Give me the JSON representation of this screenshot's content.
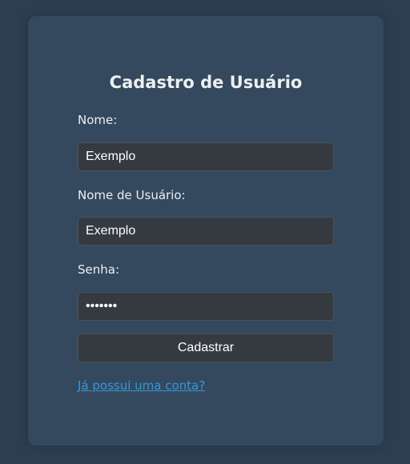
{
  "form": {
    "title": "Cadastro de Usuário",
    "name_label": "Nome:",
    "name_value": "Exemplo",
    "username_label": "Nome de Usuário:",
    "username_value": "Exemplo",
    "password_label": "Senha:",
    "password_value": "1234567",
    "submit_label": "Cadastrar",
    "login_link": "Já possui uma conta?"
  },
  "colors": {
    "page_background": "#2c3e50",
    "card_background": "#34495e",
    "field_background": "#343a40",
    "link": "#3498db",
    "text": "#ecf0f1"
  }
}
